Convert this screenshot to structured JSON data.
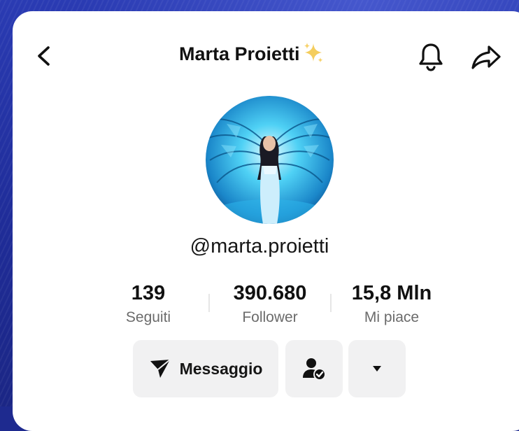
{
  "header": {
    "title": "Marta Proietti",
    "back_icon": "chevron-left-icon",
    "title_decoration_icon": "sparkles-icon",
    "notifications_icon": "bell-icon",
    "share_icon": "share-arrow-icon"
  },
  "profile": {
    "avatar_icon": "avatar",
    "username": "@marta.proietti"
  },
  "stats": [
    {
      "value": "139",
      "label": "Seguiti"
    },
    {
      "value": "390.680",
      "label": "Follower"
    },
    {
      "value": "15,8 Mln",
      "label": "Mi piace"
    }
  ],
  "actions": {
    "message_label": "Messaggio",
    "message_icon": "send-icon",
    "friend_icon": "user-check-icon",
    "more_icon": "caret-down-icon"
  },
  "colors": {
    "background": "#1f2c98",
    "card": "#ffffff",
    "button_bg": "#f1f1f2",
    "secondary_text": "#6b6b6b",
    "sparkle": "#f3c84b"
  }
}
